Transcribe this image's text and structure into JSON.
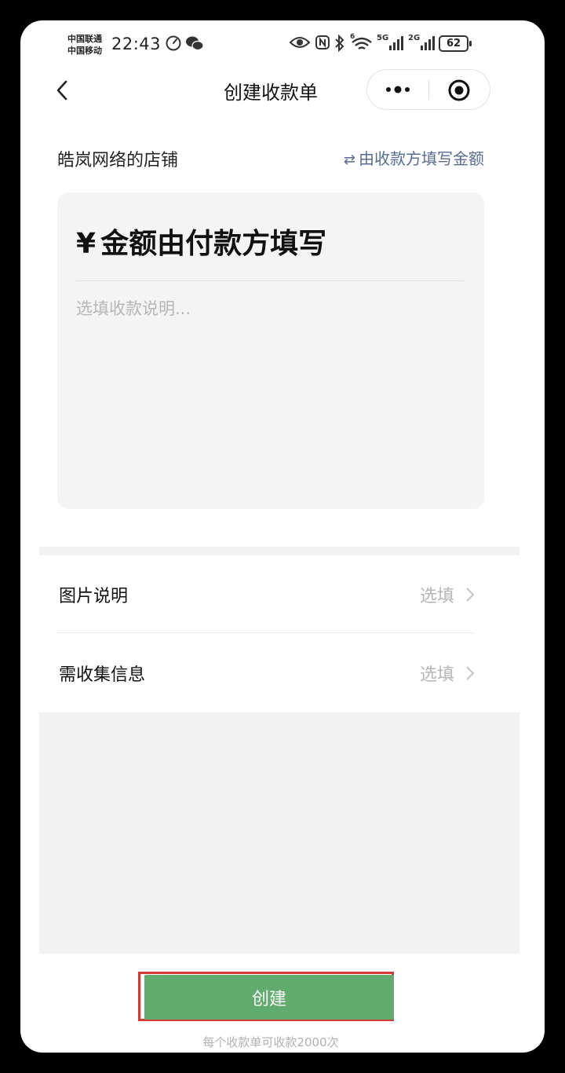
{
  "status_bar": {
    "carrier_1": "中国联通",
    "carrier_2": "中国移动",
    "time": "22:43",
    "battery": "62",
    "network_1": "5G",
    "network_2": "2G",
    "wifi_badge": "6"
  },
  "nav": {
    "title": "创建收款单",
    "back_icon": "chevron-left-icon",
    "more_icon": "more-dots-icon",
    "close_icon": "target-circle-icon"
  },
  "shop": {
    "name": "皓岚网络的店铺",
    "switch_label": "由收款方填写金额",
    "switch_icon": "⇄"
  },
  "amount_card": {
    "currency_symbol": "¥",
    "amount_text": "金额由付款方填写",
    "memo_placeholder": "选填收款说明..."
  },
  "list": [
    {
      "label": "图片说明",
      "value": "选填"
    },
    {
      "label": "需收集信息",
      "value": "选填"
    }
  ],
  "create_button": {
    "label": "创建"
  },
  "footer_note": "每个收款单可收款2000次",
  "colors": {
    "accent_green": "#62ab6f",
    "link_blue": "#576b95",
    "highlight_red": "#d53b33"
  }
}
